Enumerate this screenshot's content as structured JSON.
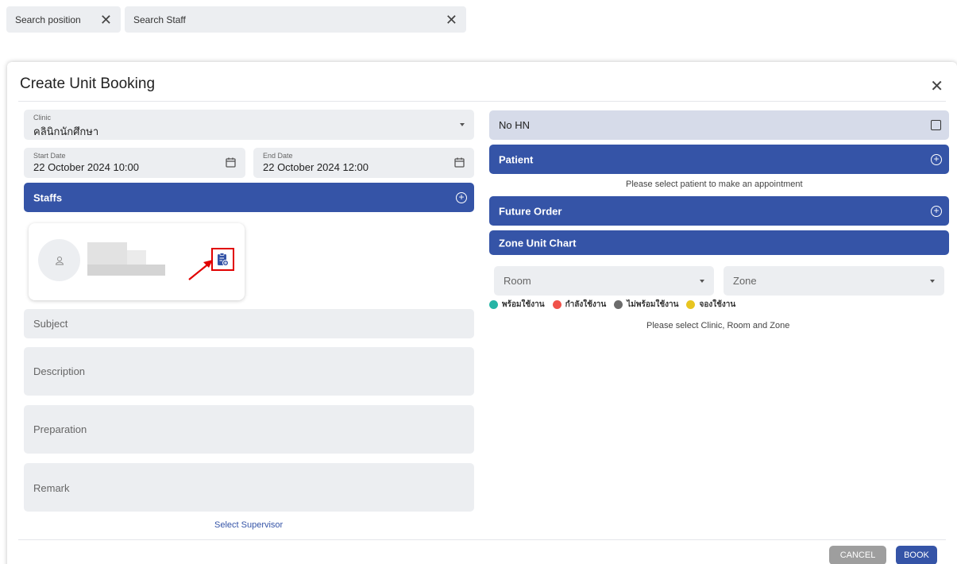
{
  "search": {
    "position_placeholder": "Search position",
    "staff_placeholder": "Search Staff"
  },
  "dialog": {
    "title": "Create Unit Booking"
  },
  "form": {
    "clinic_label": "Clinic",
    "clinic_value": "คลินิกนักศึกษา",
    "start_date_label": "Start Date",
    "start_date_value": "22 October 2024 10:00",
    "end_date_label": "End Date",
    "end_date_value": "22 October 2024 12:00",
    "staffs_header": "Staffs",
    "subject_placeholder": "Subject",
    "description_placeholder": "Description",
    "preparation_placeholder": "Preparation",
    "remark_placeholder": "Remark",
    "select_supervisor": "Select Supervisor"
  },
  "right": {
    "no_hn_label": "No HN",
    "patient_header": "Patient",
    "patient_message": "Please select patient to make an appointment",
    "future_order_header": "Future Order",
    "zone_unit_chart_header": "Zone Unit Chart",
    "room_placeholder": "Room",
    "zone_placeholder": "Zone",
    "zone_message": "Please select Clinic, Room and Zone",
    "legend": [
      {
        "label": "พร้อมใช้งาน",
        "color": "#26b5a6"
      },
      {
        "label": "กำลังใช้งาน",
        "color": "#f0524a"
      },
      {
        "label": "ไม่พร้อมใช้งาน",
        "color": "#6b6b6b"
      },
      {
        "label": "จองใช้งาน",
        "color": "#e8c520"
      }
    ]
  },
  "actions": {
    "cancel_label": "CANCEL",
    "book_label": "BOOK"
  },
  "colors": {
    "primary": "#3554a7",
    "field_bg": "#eceef1",
    "highlight": "#e10000"
  }
}
